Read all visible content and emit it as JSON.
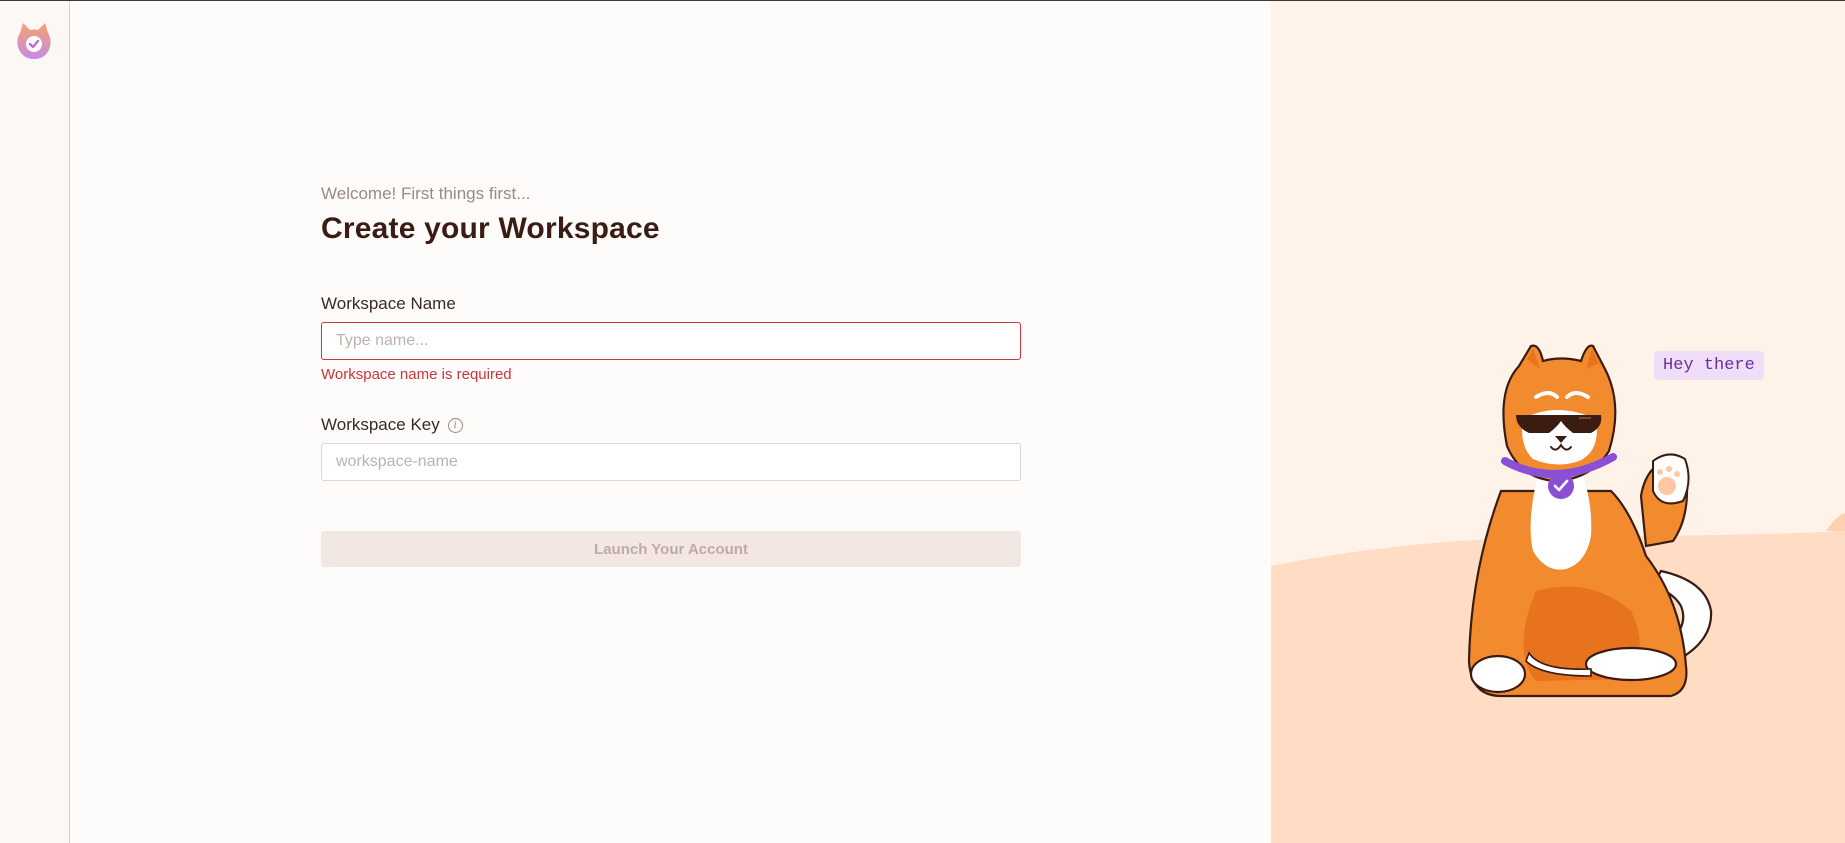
{
  "app": {
    "logo_icon": "cat-check-logo-icon"
  },
  "form": {
    "subtitle": "Welcome! First things first...",
    "title": "Create your Workspace",
    "workspace_name": {
      "label": "Workspace Name",
      "placeholder": "Type name...",
      "value": "",
      "error": "Workspace name is required"
    },
    "workspace_key": {
      "label": "Workspace Key",
      "info_icon": "info-icon",
      "placeholder": "workspace-name",
      "value": ""
    },
    "submit_label": "Launch Your Account"
  },
  "illustration": {
    "speech_text": "Hey there",
    "mascot": "cat-with-sunglasses-waving"
  },
  "colors": {
    "error": "#c8353d",
    "title": "#3b1c12",
    "accent_orange": "#f28a2e",
    "accent_purple": "#8b4fd6"
  }
}
